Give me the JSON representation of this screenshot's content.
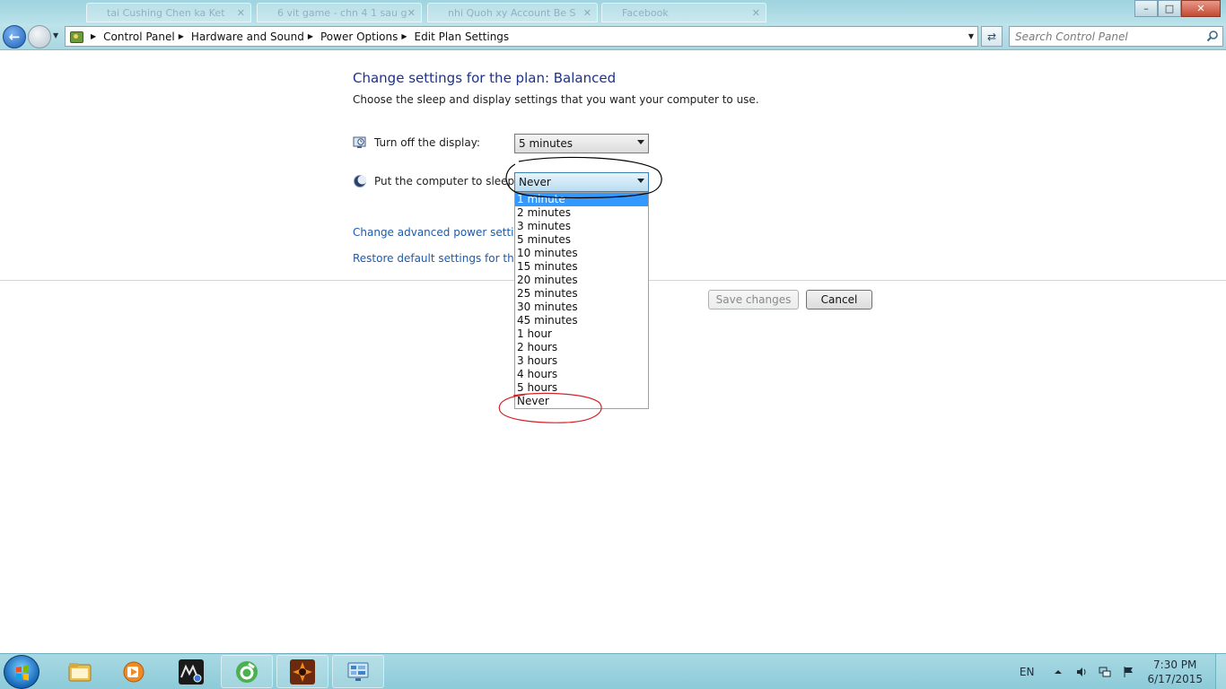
{
  "window": {
    "background_tabs": [
      "tai Cushing Chen ka Ket",
      "6 vit game - chn 4 1 sau g",
      "nhi Quoh xy Account Be S",
      "Facebook"
    ],
    "minimize_label": "–",
    "maximize_label": "□",
    "close_label": "✕"
  },
  "address_bar": {
    "breadcrumbs": [
      "Control Panel",
      "Hardware and Sound",
      "Power Options",
      "Edit Plan Settings"
    ],
    "search_placeholder": "Search Control Panel"
  },
  "main": {
    "title": "Change settings for the plan: Balanced",
    "subtitle": "Choose the sleep and display settings that you want your computer to use.",
    "display_setting": {
      "label": "Turn off the display:",
      "value": "5 minutes",
      "icon": "monitor-icon"
    },
    "sleep_setting": {
      "label": "Put the computer to sleep:",
      "value": "Never",
      "icon": "moon-icon",
      "options": [
        "1 minute",
        "2 minutes",
        "3 minutes",
        "5 minutes",
        "10 minutes",
        "15 minutes",
        "20 minutes",
        "25 minutes",
        "30 minutes",
        "45 minutes",
        "1 hour",
        "2 hours",
        "3 hours",
        "4 hours",
        "5 hours",
        "Never"
      ],
      "highlighted_option": "1 minute"
    },
    "advanced_link": "Change advanced power settings",
    "restore_link": "Restore default settings for this plan",
    "save_button": "Save changes",
    "cancel_button": "Cancel"
  },
  "taskbar": {
    "pinned": [
      "windows-explorer-icon",
      "media-player-icon",
      "mu-game-icon",
      "coccoc-browser-icon",
      "game-launcher-icon",
      "control-panel-icon"
    ],
    "language": "EN",
    "time": "7:30 PM",
    "date": "6/17/2015"
  },
  "colors": {
    "title_text": "#1e3287",
    "link_text": "#1e5aa8",
    "selection": "#3399ff",
    "annotation_red": "#d4222a",
    "annotation_black": "#000000"
  }
}
